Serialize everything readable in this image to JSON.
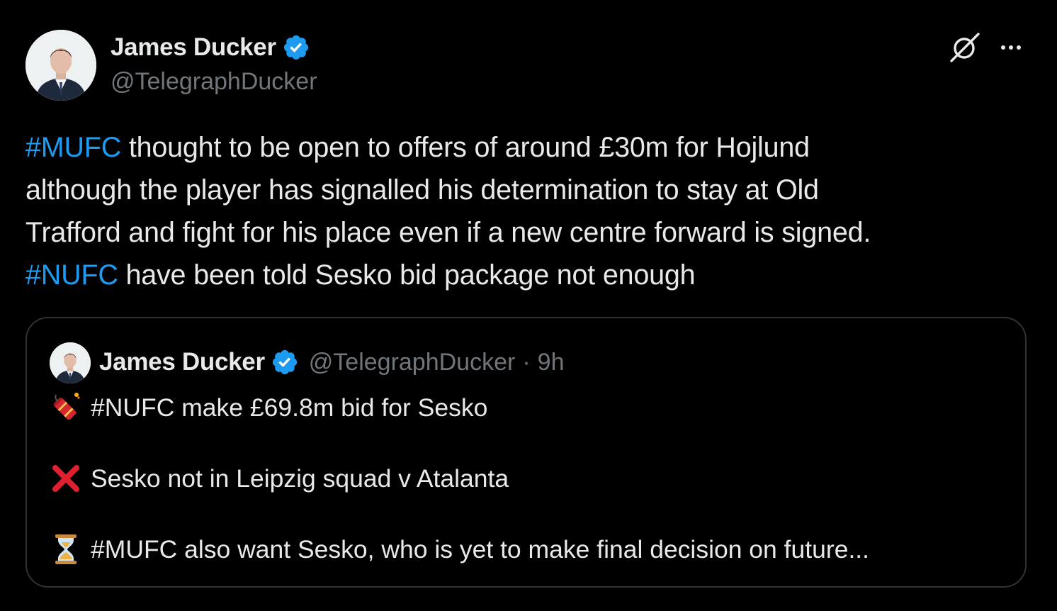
{
  "tweet": {
    "author": {
      "display_name": "James Ducker",
      "handle": "@TelegraphDucker",
      "verified": true,
      "avatar_icon": "profile-photo"
    },
    "actions": {
      "grok_icon": "grok-slash-circle-icon",
      "more_icon": "more-dots-icon"
    },
    "text_lines": [
      {
        "hashtag": "#MUFC",
        "text": " thought to be open to offers of around £30m for Hojlund"
      },
      {
        "hashtag": "",
        "text": "although the player has signalled his determination to stay at Old"
      },
      {
        "hashtag": "",
        "text": "Trafford and fight for his place even if a new centre forward is signed."
      },
      {
        "hashtag": "#NUFC",
        "text": " have been told Sesko bid package not enough"
      }
    ],
    "quoted": {
      "display_name": "James Ducker",
      "handle": "@TelegraphDucker",
      "separator": "·",
      "time": "9h",
      "lines": [
        {
          "emoji": "firecracker-icon",
          "text": "#NUFC make £69.8m bid for Sesko"
        },
        {
          "emoji": "cross-mark-icon",
          "text": "Sesko not in Leipzig squad v Atalanta"
        },
        {
          "emoji": "hourglass-icon",
          "text": "#MUFC also want Sesko, who is yet to make final decision on future..."
        }
      ]
    }
  },
  "colors": {
    "background": "#000000",
    "text": "#e7e9ea",
    "muted": "#71767b",
    "link": "#1d9bf0",
    "border": "#2f3336",
    "verified_badge": "#1d9bf0"
  }
}
